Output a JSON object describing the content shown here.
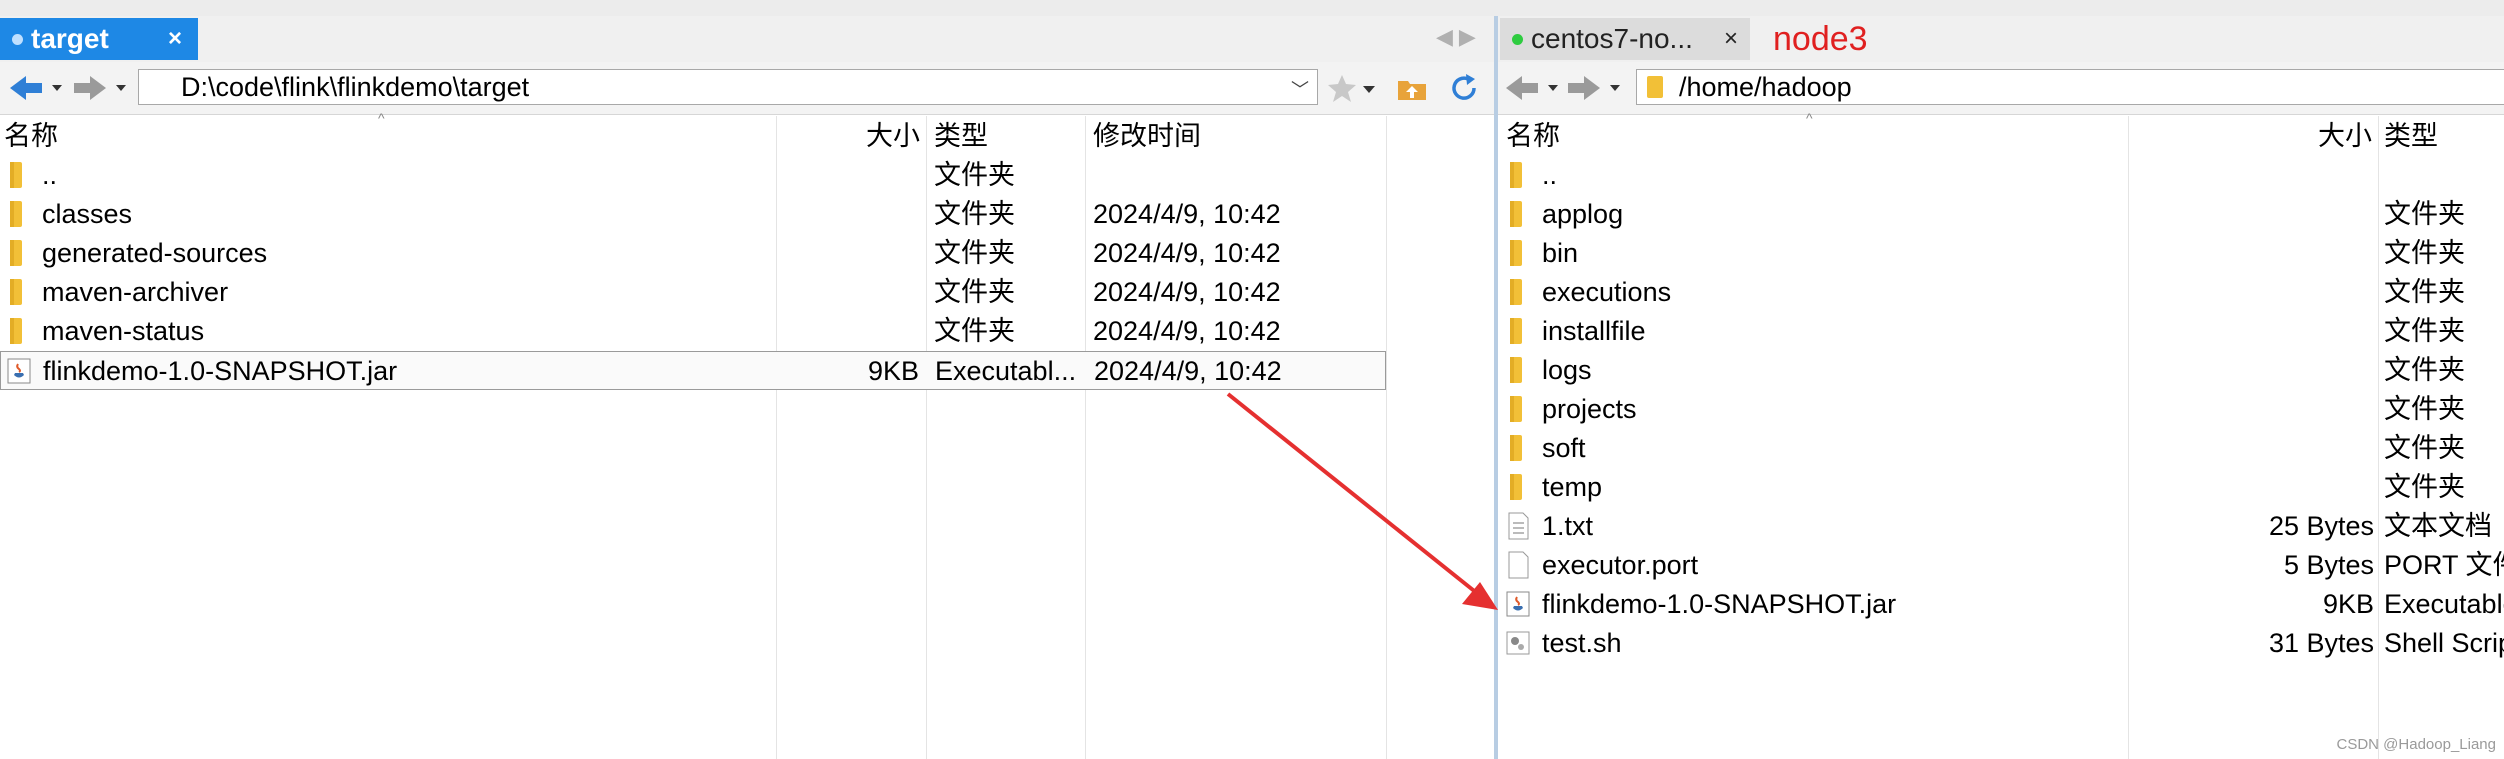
{
  "colors": {
    "accent_tab": "#1e88e5",
    "annotation_red": "#e02020",
    "folder": "#f2c037",
    "session_dot": "#2ecc40"
  },
  "left": {
    "tab": {
      "label": "target",
      "close": "×"
    },
    "path": "D:\\code\\flink\\flinkdemo\\target",
    "columns": {
      "name": "名称",
      "size": "大小",
      "type": "类型",
      "modified": "修改时间"
    },
    "rows": [
      {
        "icon": "folder-icon",
        "name": "..",
        "size": "",
        "type": "文件夹",
        "modified": ""
      },
      {
        "icon": "folder-icon",
        "name": "classes",
        "size": "",
        "type": "文件夹",
        "modified": "2024/4/9, 10:42"
      },
      {
        "icon": "folder-icon",
        "name": "generated-sources",
        "size": "",
        "type": "文件夹",
        "modified": "2024/4/9, 10:42"
      },
      {
        "icon": "folder-icon",
        "name": "maven-archiver",
        "size": "",
        "type": "文件夹",
        "modified": "2024/4/9, 10:42"
      },
      {
        "icon": "folder-icon",
        "name": "maven-status",
        "size": "",
        "type": "文件夹",
        "modified": "2024/4/9, 10:42"
      },
      {
        "icon": "jar-icon",
        "name": "flinkdemo-1.0-SNAPSHOT.jar",
        "size": "9KB",
        "type": "Executabl...",
        "modified": "2024/4/9, 10:42",
        "selected": true
      }
    ]
  },
  "right": {
    "tab": {
      "label": "centos7-no...",
      "close": "×"
    },
    "annotation": "node3",
    "path": "/home/hadoop",
    "columns": {
      "name": "名称",
      "size": "大小",
      "type": "类型"
    },
    "rows": [
      {
        "icon": "folder-icon",
        "name": "..",
        "size": "",
        "type": ""
      },
      {
        "icon": "folder-icon",
        "name": "applog",
        "size": "",
        "type": "文件夹"
      },
      {
        "icon": "folder-icon",
        "name": "bin",
        "size": "",
        "type": "文件夹"
      },
      {
        "icon": "folder-icon",
        "name": "executions",
        "size": "",
        "type": "文件夹"
      },
      {
        "icon": "folder-icon",
        "name": "installfile",
        "size": "",
        "type": "文件夹"
      },
      {
        "icon": "folder-icon",
        "name": "logs",
        "size": "",
        "type": "文件夹"
      },
      {
        "icon": "folder-icon",
        "name": "projects",
        "size": "",
        "type": "文件夹"
      },
      {
        "icon": "folder-icon",
        "name": "soft",
        "size": "",
        "type": "文件夹"
      },
      {
        "icon": "folder-icon",
        "name": "temp",
        "size": "",
        "type": "文件夹"
      },
      {
        "icon": "text-file-icon",
        "name": "1.txt",
        "size": "25 Bytes",
        "type": "文本文档"
      },
      {
        "icon": "file-icon",
        "name": "executor.port",
        "size": "5 Bytes",
        "type": "PORT 文件"
      },
      {
        "icon": "jar-icon",
        "name": "flinkdemo-1.0-SNAPSHOT.jar",
        "size": "9KB",
        "type": "Executable"
      },
      {
        "icon": "script-icon",
        "name": "test.sh",
        "size": "31 Bytes",
        "type": "Shell Script"
      }
    ]
  },
  "watermark": "CSDN @Hadoop_Liang"
}
